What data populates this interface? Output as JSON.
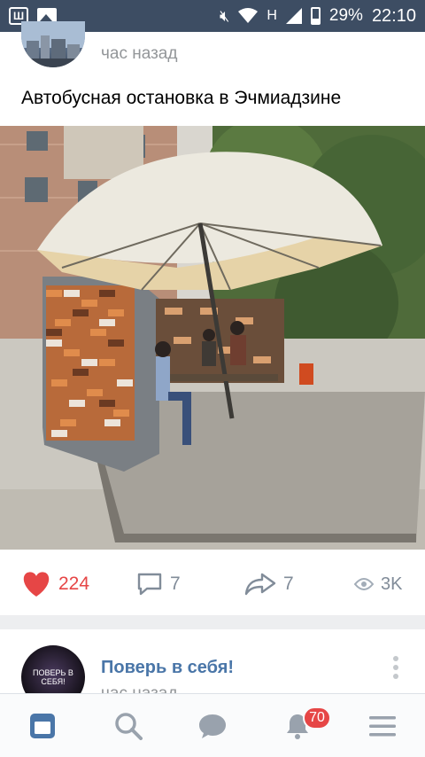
{
  "status_bar": {
    "app_icon_letter": "Ш",
    "network": "H",
    "battery_percent": "29%",
    "battery_level": 0.29,
    "time": "22:10"
  },
  "post": {
    "time": "час назад",
    "text": "Автобусная остановка в Эчмиадзине",
    "likes": "224",
    "comments": "7",
    "shares": "7",
    "views": "3K"
  },
  "next_post": {
    "group_name": "Поверь в себя!",
    "avatar_text": "ПОВЕРЬ В СЕБЯ!",
    "time": "час назад"
  },
  "tabbar": {
    "notifications_badge": "70"
  },
  "colors": {
    "accent": "#4a76a8",
    "like": "#e64646",
    "status_bar": "#3d4d63"
  }
}
